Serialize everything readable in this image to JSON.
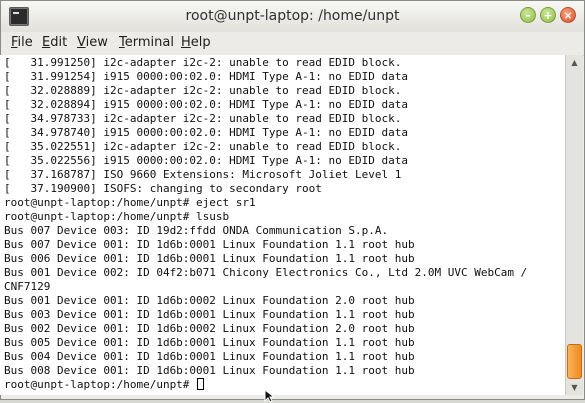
{
  "window": {
    "title": "root@unpt-laptop: /home/unpt",
    "controls": {
      "minimize": "–",
      "maximize": "+",
      "close": "×"
    }
  },
  "menubar": {
    "items": [
      "File",
      "Edit",
      "View",
      "Terminal",
      "Help"
    ]
  },
  "terminal": {
    "lines": [
      "[   31.991250] i2c-adapter i2c-2: unable to read EDID block.",
      "[   31.991254] i915 0000:00:02.0: HDMI Type A-1: no EDID data",
      "[   32.028889] i2c-adapter i2c-2: unable to read EDID block.",
      "[   32.028894] i915 0000:00:02.0: HDMI Type A-1: no EDID data",
      "[   34.978733] i2c-adapter i2c-2: unable to read EDID block.",
      "[   34.978740] i915 0000:00:02.0: HDMI Type A-1: no EDID data",
      "[   35.022551] i2c-adapter i2c-2: unable to read EDID block.",
      "[   35.022556] i915 0000:00:02.0: HDMI Type A-1: no EDID data",
      "[   37.168787] ISO 9660 Extensions: Microsoft Joliet Level 1",
      "[   37.190900] ISOFS: changing to secondary root",
      "root@unpt-laptop:/home/unpt# eject sr1",
      "root@unpt-laptop:/home/unpt# lsusb",
      "Bus 007 Device 003: ID 19d2:ffdd ONDA Communication S.p.A.",
      "Bus 007 Device 001: ID 1d6b:0001 Linux Foundation 1.1 root hub",
      "Bus 006 Device 001: ID 1d6b:0001 Linux Foundation 1.1 root hub",
      "Bus 001 Device 002: ID 04f2:b071 Chicony Electronics Co., Ltd 2.0M UVC WebCam /",
      "CNF7129",
      "Bus 001 Device 001: ID 1d6b:0002 Linux Foundation 2.0 root hub",
      "Bus 003 Device 001: ID 1d6b:0001 Linux Foundation 1.1 root hub",
      "Bus 002 Device 001: ID 1d6b:0002 Linux Foundation 2.0 root hub",
      "Bus 005 Device 001: ID 1d6b:0001 Linux Foundation 1.1 root hub",
      "Bus 004 Device 001: ID 1d6b:0001 Linux Foundation 1.1 root hub",
      "Bus 008 Device 001: ID 1d6b:0001 Linux Foundation 1.1 root hub"
    ],
    "prompt": "root@unpt-laptop:/home/unpt# "
  },
  "scrollbar": {
    "up_arrow": "▲",
    "down_arrow": "▼",
    "position_fraction": 0.97
  },
  "colors": {
    "terminal_bg": "#ffffff",
    "terminal_fg": "#111111",
    "scroll_thumb": "#f08a1e",
    "close_button": "#d94f25",
    "min_max_button": "#8fbf3e"
  }
}
